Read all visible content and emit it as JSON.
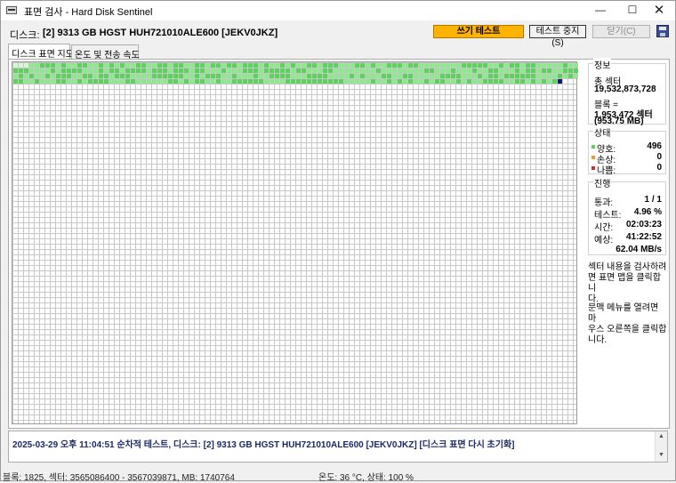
{
  "window": {
    "title": "표면 검사 - Hard Disk Sentinel",
    "minimize": "—",
    "maximize": "☐",
    "close": "✕"
  },
  "disk": {
    "label": "디스크:",
    "value": "[2] 9313 GB  HGST HUH721010ALE600 [JEKV0JKZ]"
  },
  "toolbar": {
    "write_test": "쓰기 테스트",
    "stop_test": "테스트 중지(S)",
    "close": "닫기(C)",
    "save_icon": "floppy-disk-icon"
  },
  "tabs": [
    {
      "label": "디스크 표면 지도",
      "active": true
    },
    {
      "label": "온도 및 전송 속도",
      "active": false
    }
  ],
  "surface_map": {
    "block_color_good": "#5ad35a",
    "block_color_good_light": "#8ee88e",
    "block_color_current": "#0b1a66",
    "block_color_pending": "#c8c8c8"
  },
  "info": {
    "title": "정보",
    "total_sectors_label": "총 섹터",
    "total_sectors_value": "19,532,873,728",
    "block_label": "블록 =",
    "block_sectors": "1,953,472 섹터",
    "block_size": "(953.75 MB)"
  },
  "status": {
    "title": "상태",
    "items": [
      {
        "label": "양호:",
        "value": "496",
        "color": "#5ad35a"
      },
      {
        "label": "손상:",
        "value": "0",
        "color": "#e0a030"
      },
      {
        "label": "나쁨:",
        "value": "0",
        "color": "#c83030"
      }
    ]
  },
  "progress": {
    "title": "진행",
    "pass_label": "통과:",
    "pass_value": "1 / 1",
    "test_label": "테스트:",
    "test_value": "4.96 %",
    "time_label": "시간:",
    "time_value": "02:03:23",
    "eta_label": "예상:",
    "eta_value": "41:22:52",
    "speed": "62.04 MB/s"
  },
  "hints": {
    "line1": [
      "섹터 내용을 검사하려",
      "면 표면 맵을 클릭합니",
      "다."
    ],
    "line2": [
      "문맥 메뉴를 열려면 마",
      "우스 오른쪽을 클릭합",
      "니다."
    ]
  },
  "log": {
    "text": "2025-03-29  오후 11:04:51   순차적 테스트, 디스크: [2] 9313 GB  HGST HUH721010ALE600 [JEKV0JKZ] [디스크 표면 다시 초기화]"
  },
  "statusbar": {
    "left": "블록: 1825, 섹터: 3565086400 - 3567039871, MB: 1740764",
    "right": "온도: 36  °C,  상태: 100 %"
  }
}
